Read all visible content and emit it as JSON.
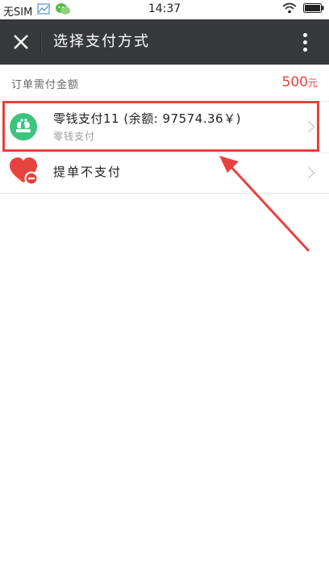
{
  "status_bar": {
    "carrier": "无SIM",
    "time": "14:37"
  },
  "title_bar": {
    "title": "选择支付方式"
  },
  "order": {
    "amount_label": "订单需付金额",
    "amount_value": "500",
    "amount_unit": "元"
  },
  "payment_options": [
    {
      "title": "零钱支付11 (余额: 97574.36￥)",
      "subtitle": "零钱支付"
    },
    {
      "title": "提单不支付"
    }
  ],
  "colors": {
    "title_bar_bg": "#38393d",
    "accent_red": "#e64340",
    "wallet_green": "#3cc481",
    "highlight_red": "#e8413f"
  }
}
